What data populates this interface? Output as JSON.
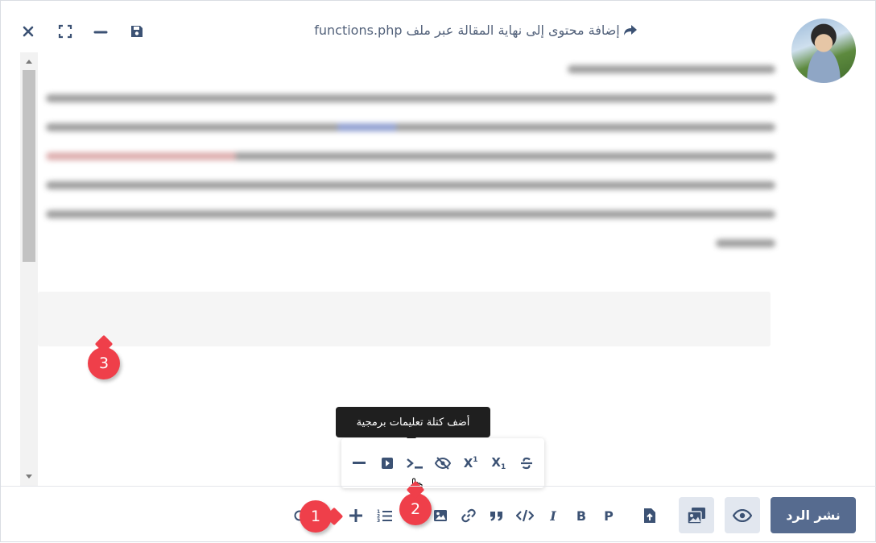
{
  "window": {
    "title": "إضافة محتوى إلى نهاية المقالة عبر ملف functions.php",
    "buttons": [
      "close-icon",
      "fullscreen-icon",
      "minimize-icon",
      "save-icon"
    ]
  },
  "callouts": {
    "one": "1",
    "two": "2",
    "three": "3"
  },
  "tooltip": {
    "text": "أضف كتلة تعليمات برمجية"
  },
  "popup_toolbar": {
    "items": [
      "strikethrough-icon",
      "subscript-icon",
      "superscript-icon",
      "hide-icon",
      "code-block-icon",
      "video-icon",
      "horizontal-rule-icon"
    ],
    "superscript": "X",
    "superscript_mark": "1",
    "subscript": "X",
    "subscript_mark": "1"
  },
  "toolbar": {
    "paragraph": "P",
    "bold": "B",
    "italic": "I",
    "items": [
      "upload-icon",
      "paragraph",
      "bold",
      "italic",
      "inline-code-icon",
      "quote-icon",
      "link-icon",
      "image-icon",
      "code-terminal-icon",
      "ordered-list-icon",
      "add-icon"
    ]
  },
  "actions": {
    "publish_label": "نشر الرد",
    "preview": "eye-icon",
    "media": "media-icon"
  },
  "colors": {
    "accent": "#566b8f",
    "callout": "#ef3f4a",
    "icon": "#3c5274"
  }
}
